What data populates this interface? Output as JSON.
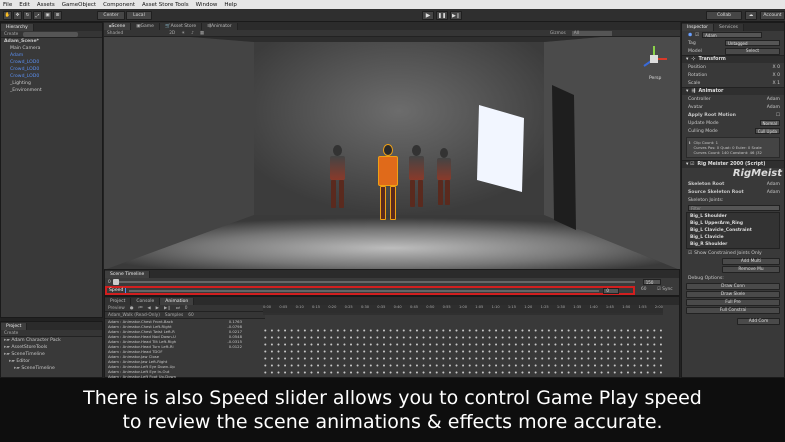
{
  "menu": [
    "File",
    "Edit",
    "Assets",
    "GameObject",
    "Component",
    "Asset Store Tools",
    "Window",
    "Help"
  ],
  "toolbar": {
    "center": "Center",
    "local": "Local",
    "collab": "Collab",
    "account": "Account"
  },
  "hierarchy": {
    "tab": "Hierarchy",
    "create": "Create",
    "items": [
      {
        "label": "Adam_Scene*",
        "indent": 0,
        "style": "bold"
      },
      {
        "label": "Main Camera",
        "indent": 2,
        "style": "normal"
      },
      {
        "label": "Adam",
        "indent": 2,
        "style": "blue"
      },
      {
        "label": "Crowd_LOD0",
        "indent": 2,
        "style": "blue"
      },
      {
        "label": "Crowd_LOD0",
        "indent": 2,
        "style": "blue"
      },
      {
        "label": "Crowd_LOD0",
        "indent": 2,
        "style": "blue"
      },
      {
        "label": "_Lighting",
        "indent": 2,
        "style": "normal"
      },
      {
        "label": "_Environment",
        "indent": 2,
        "style": "normal"
      }
    ]
  },
  "scene_tabs": [
    "Scene",
    "Game",
    "Asset Store",
    "Animator"
  ],
  "scene_sub": {
    "shading": "Shaded",
    "mode": "2D",
    "gizmos": "Gizmos",
    "search": "All"
  },
  "gizmo_label": "Persp",
  "timeline": {
    "title": "Scene Timeline",
    "start": "0",
    "end": "150",
    "speed_label": "Speed",
    "speed_value": "0",
    "fps": "60",
    "sync": "Sync"
  },
  "project": {
    "tabs": [
      "Project",
      "Console",
      "Animation"
    ],
    "create": "Create",
    "items": [
      {
        "label": "Adam Character Pack",
        "indent": 0
      },
      {
        "label": "AssetStoreTools",
        "indent": 0
      },
      {
        "label": "SceneTimeline",
        "indent": 0
      },
      {
        "label": "Editor",
        "indent": 1
      },
      {
        "label": "SceneTimeline",
        "indent": 2
      }
    ]
  },
  "animation": {
    "preview": "Preview",
    "clip": "Adam_Walk (Read-Only)",
    "samples_label": "Samples",
    "samples": "60",
    "frame": "0",
    "ticks": [
      "0:00",
      "0:05",
      "0:10",
      "0:15",
      "0:20",
      "0:25",
      "0:30",
      "0:35",
      "0:40",
      "0:45",
      "0:50",
      "0:55",
      "1:00",
      "1:05",
      "1:10",
      "1:15",
      "1:20",
      "1:25",
      "1:30",
      "1:35",
      "1:40",
      "1:45",
      "1:50",
      "1:55",
      "2:00"
    ],
    "properties": [
      {
        "name": "Adam : Animator.Chest Front-Back",
        "value": "0.1763"
      },
      {
        "name": "Adam : Animator.Chest Left-Right",
        "value": "-0.0798"
      },
      {
        "name": "Adam : Animator.Chest Twist Left-R",
        "value": "0.0217"
      },
      {
        "name": "Adam : Animator.Head Nod Down-U",
        "value": "0.0548"
      },
      {
        "name": "Adam : Animator.Head Tilt Left-Righ",
        "value": "-0.0315"
      },
      {
        "name": "Adam : Animator.Head Turn Left-Ri",
        "value": "0.0122"
      },
      {
        "name": "Adam : Animator.Head TDOF",
        "value": ""
      },
      {
        "name": "Adam : Animator.Jaw Close",
        "value": ""
      },
      {
        "name": "Adam : Animator.Jaw Left-Right",
        "value": ""
      },
      {
        "name": "Adam : Animator.Left Eye Down-Up",
        "value": ""
      },
      {
        "name": "Adam : Animator.Left Eye In-Out",
        "value": ""
      },
      {
        "name": "Adam : Animator.Left Foot Up-Down",
        "value": ""
      }
    ]
  },
  "inspector": {
    "tabs": [
      "Inspector",
      "Services"
    ],
    "object": "Adam",
    "tag_label": "Tag",
    "tag": "Untagged",
    "model_label": "Model",
    "model_btn": "Select",
    "transform": "Transform",
    "position": "Position",
    "rotation": "Rotation",
    "scale": "Scale",
    "pos_x": "X 0",
    "rot_x": "X 0",
    "scale_x": "X 1",
    "animator": "Animator",
    "controller": "Controller",
    "controller_val": "Adam",
    "avatar": "Avatar",
    "avatar_val": "Adam",
    "root_motion": "Apply Root Motion",
    "update_mode": "Update Mode",
    "update_val": "Normal",
    "culling": "Culling Mode",
    "culling_val": "Cull Upda",
    "clip_info": [
      "Clip Count: 1",
      "Curves Pos: 0 Quat: 0 Euler: 0 Scale",
      "Curves Count: 140 Constant: 46 (32"
    ],
    "script": "Rig Meister 2000 (Script)",
    "brand": "RigMeist",
    "skeleton_root": "Skeleton Root",
    "skeleton_root_val": "Adam",
    "source_root": "Source Skeleton Root",
    "source_root_val": "Adam",
    "joints_label": "Skeleton Joints:",
    "filter": "Filter",
    "joints": [
      "Big_L Shoulder",
      "Big_L UpperArm_Ring",
      "Big_L Clavicle_Constraint",
      "Big_L Clavicle",
      "Big_R Shoulder"
    ],
    "constrained": "Show Constrained Joints Only",
    "add_multi": "Add Multi",
    "remove_multi": "Remove Mu",
    "debug": "Debug Options:",
    "draw_btns": [
      "Draw Conn",
      "Draw Skele",
      "Full Pre",
      "Full Constrai"
    ],
    "add_component": "Add Com"
  },
  "caption": {
    "line1": "There is also Speed slider allows you to control Game Play speed",
    "line2": "to review the scene animations & effects more accurate."
  },
  "colors": {
    "highlight": "#d21f1f",
    "selection": "#f0a014",
    "light_panel": "#f2f6ff"
  }
}
